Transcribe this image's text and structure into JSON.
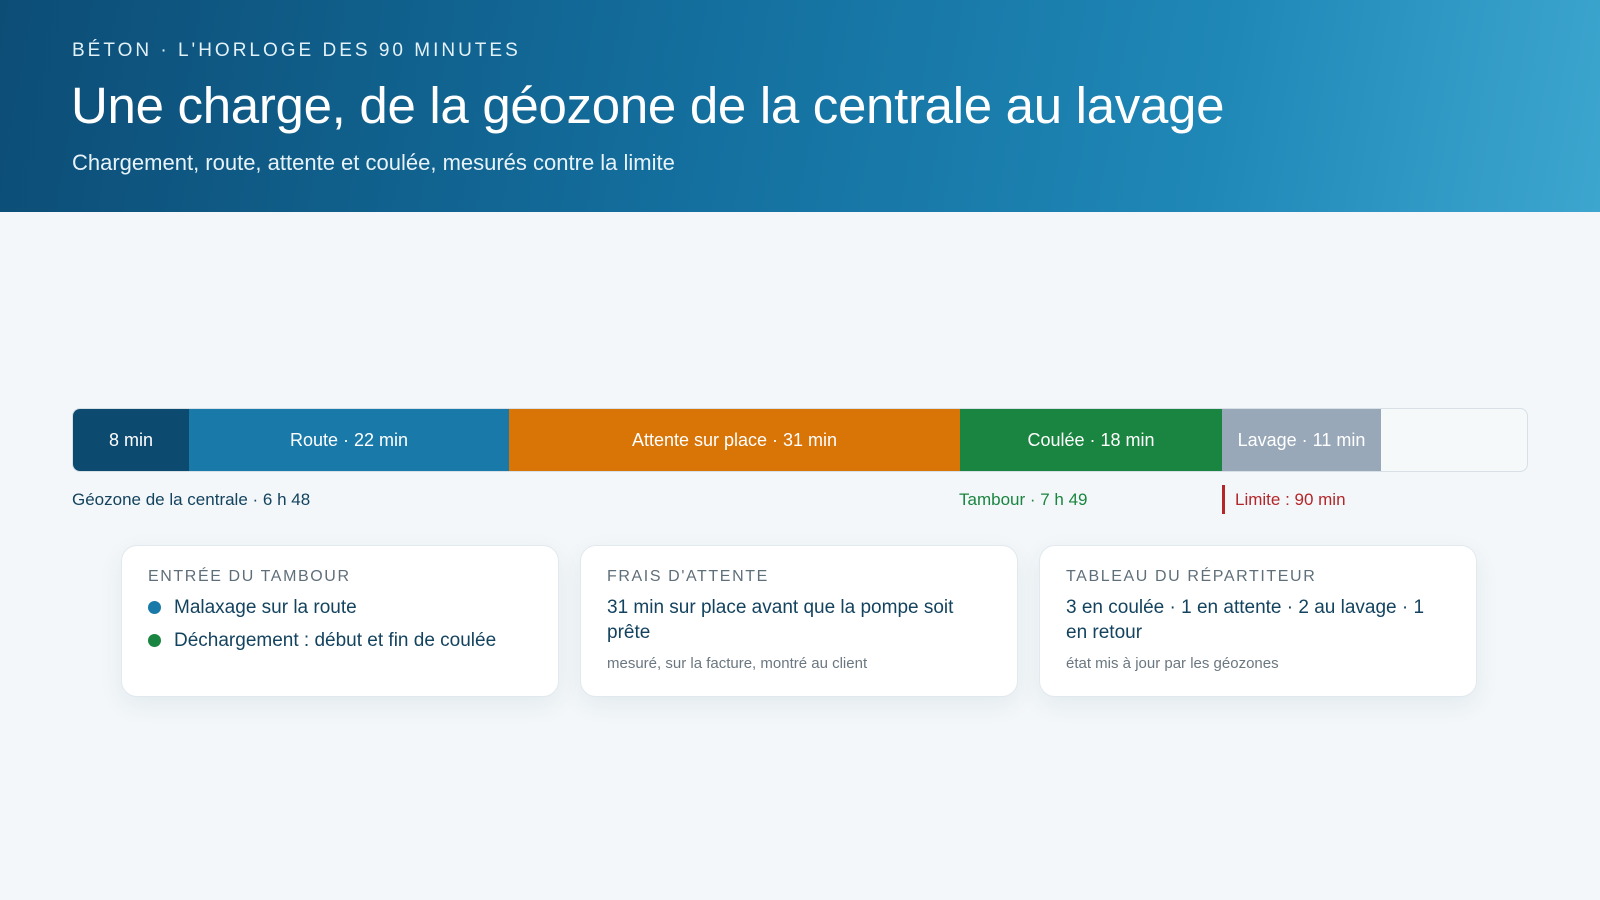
{
  "header": {
    "eyebrow": "BÉTON · L'HORLOGE DES 90 MINUTES",
    "title": "Une charge, de la géozone de la centrale au lavage",
    "subtitle": "Chargement, route, attente et coulée, mesurés contre la limite"
  },
  "timeline": {
    "segments": [
      {
        "label": "8 min",
        "minutes": 8,
        "color": "#0d4a70"
      },
      {
        "label": "Route · 22 min",
        "minutes": 22,
        "color": "#197aaa"
      },
      {
        "label": "Attente sur place · 31 min",
        "minutes": 31,
        "color": "#d97406"
      },
      {
        "label": "Coulée · 18 min",
        "minutes": 18,
        "color": "#1a8540"
      },
      {
        "label": "Lavage · 11 min",
        "minutes": 11,
        "color": "#98a8b9"
      }
    ],
    "markers": {
      "geozone": "Géozone de la centrale · 6 h 48",
      "tambour": "Tambour · 7 h 49",
      "limite": "Limite : 90 min"
    }
  },
  "cards": {
    "tambour": {
      "label": "ENTRÉE DU TAMBOUR",
      "items": [
        {
          "text": "Malaxage sur la route",
          "color": "#197aaa"
        },
        {
          "text": "Déchargement : début et fin de coulée",
          "color": "#1a8540"
        }
      ]
    },
    "attente": {
      "label": "FRAIS D'ATTENTE",
      "text": "31 min sur place avant que la pompe soit prête",
      "note": "mesuré, sur la facture, montré au client"
    },
    "repartiteur": {
      "label": "TABLEAU DU RÉPARTITEUR",
      "text": "3 en coulée · 1 en attente · 2 au lavage · 1 en retour",
      "note": "état mis à jour par les géozones"
    }
  }
}
